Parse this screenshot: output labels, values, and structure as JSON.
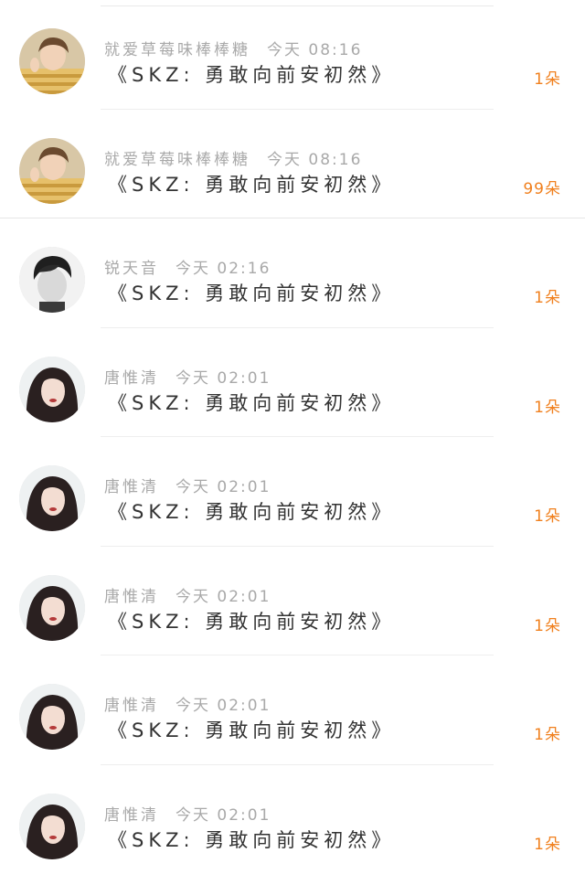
{
  "gifts": [
    {
      "user": "就爱草莓味棒棒糖",
      "time": "今天 08:16",
      "message": "《SKZ: 勇敢向前安初然》",
      "count": "1朵",
      "avatar": "boy-striped-shirt"
    },
    {
      "user": "就爱草莓味棒棒糖",
      "time": "今天 08:16",
      "message": "《SKZ: 勇敢向前安初然》",
      "count": "99朵",
      "avatar": "boy-striped-shirt"
    },
    {
      "user": "锐天音",
      "time": "今天 02:16",
      "message": "《SKZ: 勇敢向前安初然》",
      "count": "1朵",
      "avatar": "boy-black-white"
    },
    {
      "user": "唐惟清",
      "time": "今天 02:01",
      "message": "《SKZ: 勇敢向前安初然》",
      "count": "1朵",
      "avatar": "woman-dark-hair"
    },
    {
      "user": "唐惟清",
      "time": "今天 02:01",
      "message": "《SKZ: 勇敢向前安初然》",
      "count": "1朵",
      "avatar": "woman-dark-hair"
    },
    {
      "user": "唐惟清",
      "time": "今天 02:01",
      "message": "《SKZ: 勇敢向前安初然》",
      "count": "1朵",
      "avatar": "woman-dark-hair"
    },
    {
      "user": "唐惟清",
      "time": "今天 02:01",
      "message": "《SKZ: 勇敢向前安初然》",
      "count": "1朵",
      "avatar": "woman-dark-hair"
    },
    {
      "user": "唐惟清",
      "time": "今天 02:01",
      "message": "《SKZ: 勇敢向前安初然》",
      "count": "1朵",
      "avatar": "woman-dark-hair"
    }
  ],
  "colors": {
    "count": "#f0801e",
    "username": "#a9a9a9",
    "message": "#333333"
  }
}
